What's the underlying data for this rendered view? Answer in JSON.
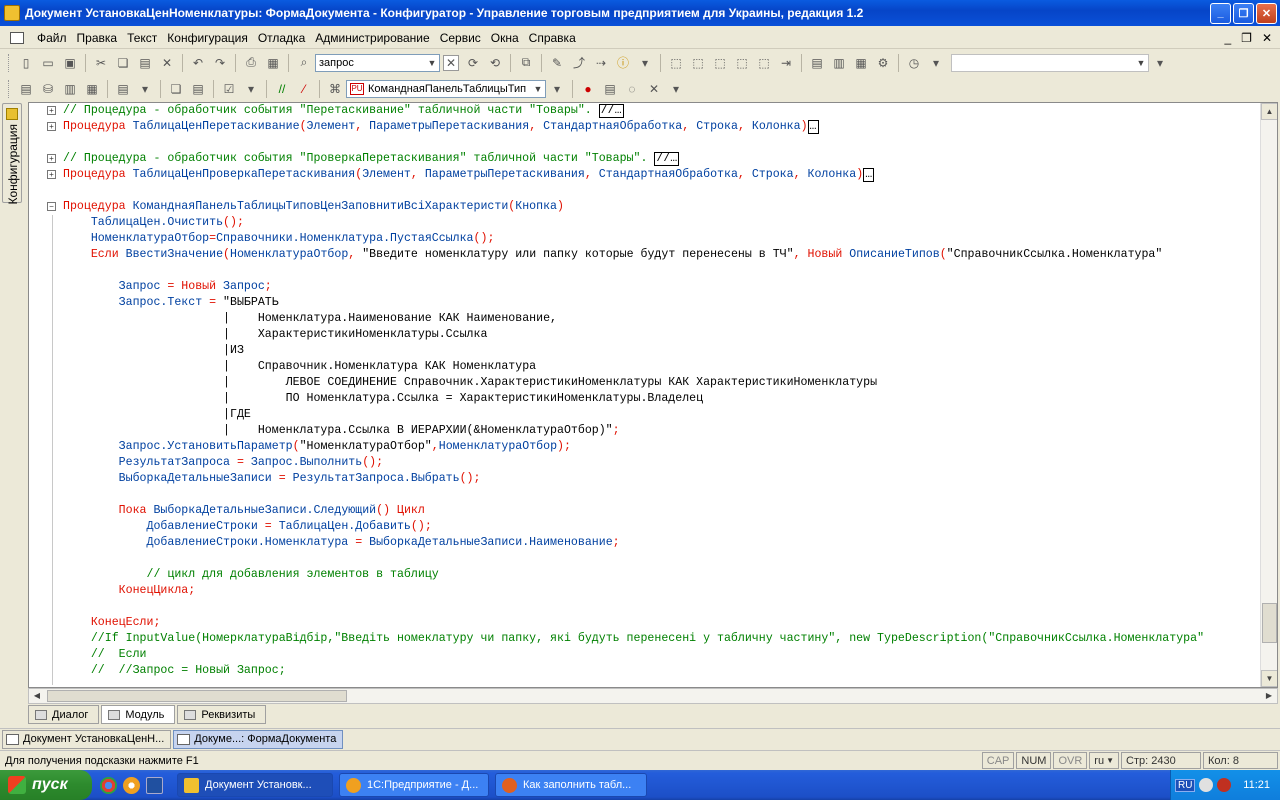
{
  "window": {
    "title": "Документ УстановкаЦенНоменклатуры: ФормаДокумента - Конфигуратор - Управление торговым предприятием для Украины, редакция 1.2"
  },
  "menu": {
    "items": [
      "Файл",
      "Правка",
      "Текст",
      "Конфигурация",
      "Отладка",
      "Администрирование",
      "Сервис",
      "Окна",
      "Справка"
    ]
  },
  "toolbar": {
    "search_value": "запрос",
    "object_combo": "КоманднаяПанельТаблицыТип",
    "empty_combo": ""
  },
  "side_panel": {
    "label": "Конфигурация"
  },
  "editor": {
    "lines": [
      {
        "fold": "+",
        "indent": 0,
        "parts": [
          {
            "c": "cm",
            "t": "// Процедура - обработчик события \"Перетаскивание\" табличной части \"Товары\". "
          },
          {
            "c": "box",
            "t": "//…"
          }
        ]
      },
      {
        "fold": "+",
        "indent": 0,
        "parts": [
          {
            "c": "kw",
            "t": "Процедура "
          },
          {
            "c": "id",
            "t": "ТаблицаЦенПеретаскивание"
          },
          {
            "c": "kw",
            "t": "("
          },
          {
            "c": "id",
            "t": "Элемент"
          },
          {
            "c": "kw",
            "t": ", "
          },
          {
            "c": "id",
            "t": "ПараметрыПеретаскивания"
          },
          {
            "c": "kw",
            "t": ", "
          },
          {
            "c": "id",
            "t": "СтандартнаяОбработка"
          },
          {
            "c": "kw",
            "t": ", "
          },
          {
            "c": "id",
            "t": "Строка"
          },
          {
            "c": "kw",
            "t": ", "
          },
          {
            "c": "id",
            "t": "Колонка"
          },
          {
            "c": "kw",
            "t": ")"
          },
          {
            "c": "box",
            "t": "…"
          }
        ]
      },
      {
        "fold": "",
        "indent": 0,
        "parts": []
      },
      {
        "fold": "+",
        "indent": 0,
        "parts": [
          {
            "c": "cm",
            "t": "// Процедура - обработчик события \"ПроверкаПеретаскивания\" табличной части \"Товары\". "
          },
          {
            "c": "box",
            "t": "//…"
          }
        ]
      },
      {
        "fold": "+",
        "indent": 0,
        "parts": [
          {
            "c": "kw",
            "t": "Процедура "
          },
          {
            "c": "id",
            "t": "ТаблицаЦенПроверкаПеретаскивания"
          },
          {
            "c": "kw",
            "t": "("
          },
          {
            "c": "id",
            "t": "Элемент"
          },
          {
            "c": "kw",
            "t": ", "
          },
          {
            "c": "id",
            "t": "ПараметрыПеретаскивания"
          },
          {
            "c": "kw",
            "t": ", "
          },
          {
            "c": "id",
            "t": "СтандартнаяОбработка"
          },
          {
            "c": "kw",
            "t": ", "
          },
          {
            "c": "id",
            "t": "Строка"
          },
          {
            "c": "kw",
            "t": ", "
          },
          {
            "c": "id",
            "t": "Колонка"
          },
          {
            "c": "kw",
            "t": ")"
          },
          {
            "c": "box",
            "t": "…"
          }
        ]
      },
      {
        "fold": "",
        "indent": 0,
        "parts": []
      },
      {
        "fold": "−",
        "indent": 0,
        "parts": [
          {
            "c": "kw",
            "t": "Процедура "
          },
          {
            "c": "id",
            "t": "КоманднаяПанельТаблицыТиповЦенЗаповнитиВсіХарактеристи"
          },
          {
            "c": "kw",
            "t": "("
          },
          {
            "c": "id",
            "t": "Кнопка"
          },
          {
            "c": "kw",
            "t": ")"
          }
        ]
      },
      {
        "fold": "",
        "indent": 4,
        "parts": [
          {
            "c": "id",
            "t": "ТаблицаЦен.Очистить"
          },
          {
            "c": "kw",
            "t": "();"
          }
        ]
      },
      {
        "fold": "",
        "indent": 4,
        "parts": [
          {
            "c": "id",
            "t": "НоменклатураОтбор"
          },
          {
            "c": "kw",
            "t": "="
          },
          {
            "c": "id",
            "t": "Справочники.Номенклатура.ПустаяСсылка"
          },
          {
            "c": "kw",
            "t": "();"
          }
        ]
      },
      {
        "fold": "",
        "indent": 4,
        "parts": [
          {
            "c": "kw",
            "t": "Если "
          },
          {
            "c": "id",
            "t": "ВвестиЗначение"
          },
          {
            "c": "kw",
            "t": "("
          },
          {
            "c": "id",
            "t": "НоменклатураОтбор"
          },
          {
            "c": "kw",
            "t": ", "
          },
          {
            "c": "st",
            "t": "\"Введите номенклатуру или папку которые будут перенесены в ТЧ\""
          },
          {
            "c": "kw",
            "t": ", Новый "
          },
          {
            "c": "id",
            "t": "ОписаниеТипов"
          },
          {
            "c": "kw",
            "t": "("
          },
          {
            "c": "st",
            "t": "\"СправочникСсылка.Номенклатура\""
          }
        ]
      },
      {
        "fold": "",
        "indent": 0,
        "parts": []
      },
      {
        "fold": "",
        "indent": 8,
        "parts": [
          {
            "c": "id",
            "t": "Запрос"
          },
          {
            "c": "kw",
            "t": " = Новый "
          },
          {
            "c": "id",
            "t": "Запрос"
          },
          {
            "c": "kw",
            "t": ";"
          }
        ]
      },
      {
        "fold": "",
        "indent": 8,
        "parts": [
          {
            "c": "id",
            "t": "Запрос.Текст"
          },
          {
            "c": "kw",
            "t": " = "
          },
          {
            "c": "st",
            "t": "\"ВЫБРАТЬ"
          }
        ]
      },
      {
        "fold": "",
        "indent": 23,
        "parts": [
          {
            "c": "st",
            "t": "|    Номенклатура.Наименование КАК Наименование,"
          }
        ]
      },
      {
        "fold": "",
        "indent": 23,
        "parts": [
          {
            "c": "st",
            "t": "|    ХарактеристикиНоменклатуры.Ссылка"
          }
        ]
      },
      {
        "fold": "",
        "indent": 23,
        "parts": [
          {
            "c": "st",
            "t": "|ИЗ"
          }
        ]
      },
      {
        "fold": "",
        "indent": 23,
        "parts": [
          {
            "c": "st",
            "t": "|    Справочник.Номенклатура КАК Номенклатура"
          }
        ]
      },
      {
        "fold": "",
        "indent": 23,
        "parts": [
          {
            "c": "st",
            "t": "|        ЛЕВОЕ СОЕДИНЕНИЕ Справочник.ХарактеристикиНоменклатуры КАК ХарактеристикиНоменклатуры"
          }
        ]
      },
      {
        "fold": "",
        "indent": 23,
        "parts": [
          {
            "c": "st",
            "t": "|        ПО Номенклатура.Ссылка = ХарактеристикиНоменклатуры.Владелец"
          }
        ]
      },
      {
        "fold": "",
        "indent": 23,
        "parts": [
          {
            "c": "st",
            "t": "|ГДЕ"
          }
        ]
      },
      {
        "fold": "",
        "indent": 23,
        "parts": [
          {
            "c": "st",
            "t": "|    Номенклатура.Ссылка В ИЕРАРХИИ(&НоменклатураОтбор)\""
          },
          {
            "c": "kw",
            "t": ";"
          }
        ]
      },
      {
        "fold": "",
        "indent": 8,
        "parts": [
          {
            "c": "id",
            "t": "Запрос.УстановитьПараметр"
          },
          {
            "c": "kw",
            "t": "("
          },
          {
            "c": "st",
            "t": "\"НоменклатураОтбор\""
          },
          {
            "c": "kw",
            "t": ","
          },
          {
            "c": "id",
            "t": "НоменклатураОтбор"
          },
          {
            "c": "kw",
            "t": ");"
          }
        ]
      },
      {
        "fold": "",
        "indent": 8,
        "parts": [
          {
            "c": "id",
            "t": "РезультатЗапроса"
          },
          {
            "c": "kw",
            "t": " = "
          },
          {
            "c": "id",
            "t": "Запрос.Выполнить"
          },
          {
            "c": "kw",
            "t": "();"
          }
        ]
      },
      {
        "fold": "",
        "indent": 8,
        "parts": [
          {
            "c": "id",
            "t": "ВыборкаДетальныеЗаписи"
          },
          {
            "c": "kw",
            "t": " = "
          },
          {
            "c": "id",
            "t": "РезультатЗапроса.Выбрать"
          },
          {
            "c": "kw",
            "t": "();"
          }
        ]
      },
      {
        "fold": "",
        "indent": 0,
        "parts": []
      },
      {
        "fold": "",
        "indent": 8,
        "parts": [
          {
            "c": "kw",
            "t": "Пока "
          },
          {
            "c": "id",
            "t": "ВыборкаДетальныеЗаписи.Следующий"
          },
          {
            "c": "kw",
            "t": "() Цикл"
          }
        ]
      },
      {
        "fold": "",
        "indent": 12,
        "parts": [
          {
            "c": "id",
            "t": "ДобавлениеСтроки"
          },
          {
            "c": "kw",
            "t": " = "
          },
          {
            "c": "id",
            "t": "ТаблицаЦен.Добавить"
          },
          {
            "c": "kw",
            "t": "();"
          }
        ]
      },
      {
        "fold": "",
        "indent": 12,
        "parts": [
          {
            "c": "id",
            "t": "ДобавлениеСтроки.Номенклатура"
          },
          {
            "c": "kw",
            "t": " = "
          },
          {
            "c": "id",
            "t": "ВыборкаДетальныеЗаписи.Наименование"
          },
          {
            "c": "kw",
            "t": ";"
          }
        ]
      },
      {
        "fold": "",
        "indent": 0,
        "parts": []
      },
      {
        "fold": "",
        "indent": 12,
        "parts": [
          {
            "c": "cm",
            "t": "// цикл для добавления элементов в таблицу"
          }
        ]
      },
      {
        "fold": "",
        "indent": 8,
        "parts": [
          {
            "c": "kw",
            "t": "КонецЦикла;"
          }
        ]
      },
      {
        "fold": "",
        "indent": 0,
        "parts": []
      },
      {
        "fold": "",
        "indent": 4,
        "parts": [
          {
            "c": "kw",
            "t": "КонецЕсли;"
          }
        ]
      },
      {
        "fold": "",
        "indent": 4,
        "parts": [
          {
            "c": "cm",
            "t": "//If InputValue(НомерклатураВідбір,\"Введіть номеклатуру чи папку, які будуть перенесені у табличну частину\", new TypeDescription(\"СправочникСсылка.Номенклатура\""
          }
        ]
      },
      {
        "fold": "",
        "indent": 4,
        "parts": [
          {
            "c": "cm",
            "t": "//  Если"
          }
        ]
      },
      {
        "fold": "",
        "indent": 4,
        "parts": [
          {
            "c": "cm",
            "t": "//  //Запрос = Новый Запрос;"
          }
        ]
      }
    ]
  },
  "form_tabs": [
    "Диалог",
    "Модуль",
    "Реквизиты"
  ],
  "window_tabs": [
    "Документ УстановкаЦенН...",
    "Докуме...: ФормаДокумента"
  ],
  "status_bar": {
    "message": "Для получения подсказки нажмите F1",
    "cap": "CAP",
    "num": "NUM",
    "ovr": "OVR",
    "lang": "ru",
    "line": "Стр: 2430",
    "col": "Кол: 8"
  },
  "taskbar": {
    "start": "пуск",
    "tasks": [
      "Документ Установк...",
      "1С:Предприятие - Д...",
      "Как заполнить табл..."
    ],
    "lang": "RU",
    "clock": "11:21"
  }
}
